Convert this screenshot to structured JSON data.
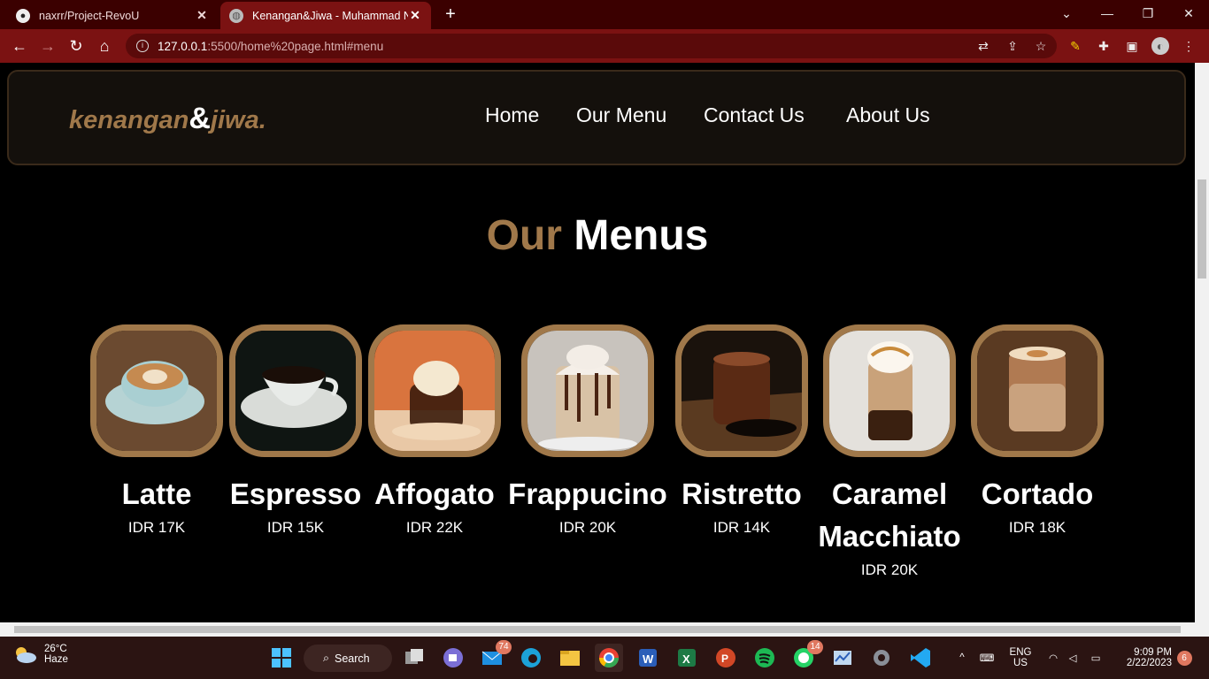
{
  "browser": {
    "tabs": [
      {
        "title": "naxrr/Project-RevoU"
      },
      {
        "title": "Kenangan&Jiwa - Muhammad N"
      }
    ],
    "url_host": "127.0.0.1",
    "url_path": ":5500/home%20page.html#menu"
  },
  "site": {
    "logo_main": "kenangan",
    "logo_amp": "&",
    "logo_tail": "jiwa.",
    "nav": [
      "Home",
      "Our Menu",
      "Contact Us",
      "About Us"
    ],
    "heading_accent": "Our",
    "heading_main": "Menus",
    "menu_items": [
      {
        "name": "Latte",
        "price": "IDR 17K"
      },
      {
        "name": "Espresso",
        "price": "IDR 15K"
      },
      {
        "name": "Affogato",
        "price": "IDR 22K"
      },
      {
        "name": "Frappucino",
        "price": "IDR 20K"
      },
      {
        "name": "Ristretto",
        "price": "IDR 14K"
      },
      {
        "name": "Caramel Macchiato",
        "price": "IDR 20K"
      },
      {
        "name": "Cortado",
        "price": "IDR 18K"
      }
    ]
  },
  "taskbar": {
    "weather_temp": "26°C",
    "weather_desc": "Haze",
    "search_label": "Search",
    "mail_badge": "74",
    "whatsapp_badge": "14",
    "lang_top": "ENG",
    "lang_bottom": "US",
    "time": "9:09 PM",
    "date": "2/22/2023",
    "notif_count": "6"
  },
  "colors": {
    "accent": "#a0784a",
    "chrome_active": "#7b1212",
    "chrome_bg": "#3b0000"
  }
}
